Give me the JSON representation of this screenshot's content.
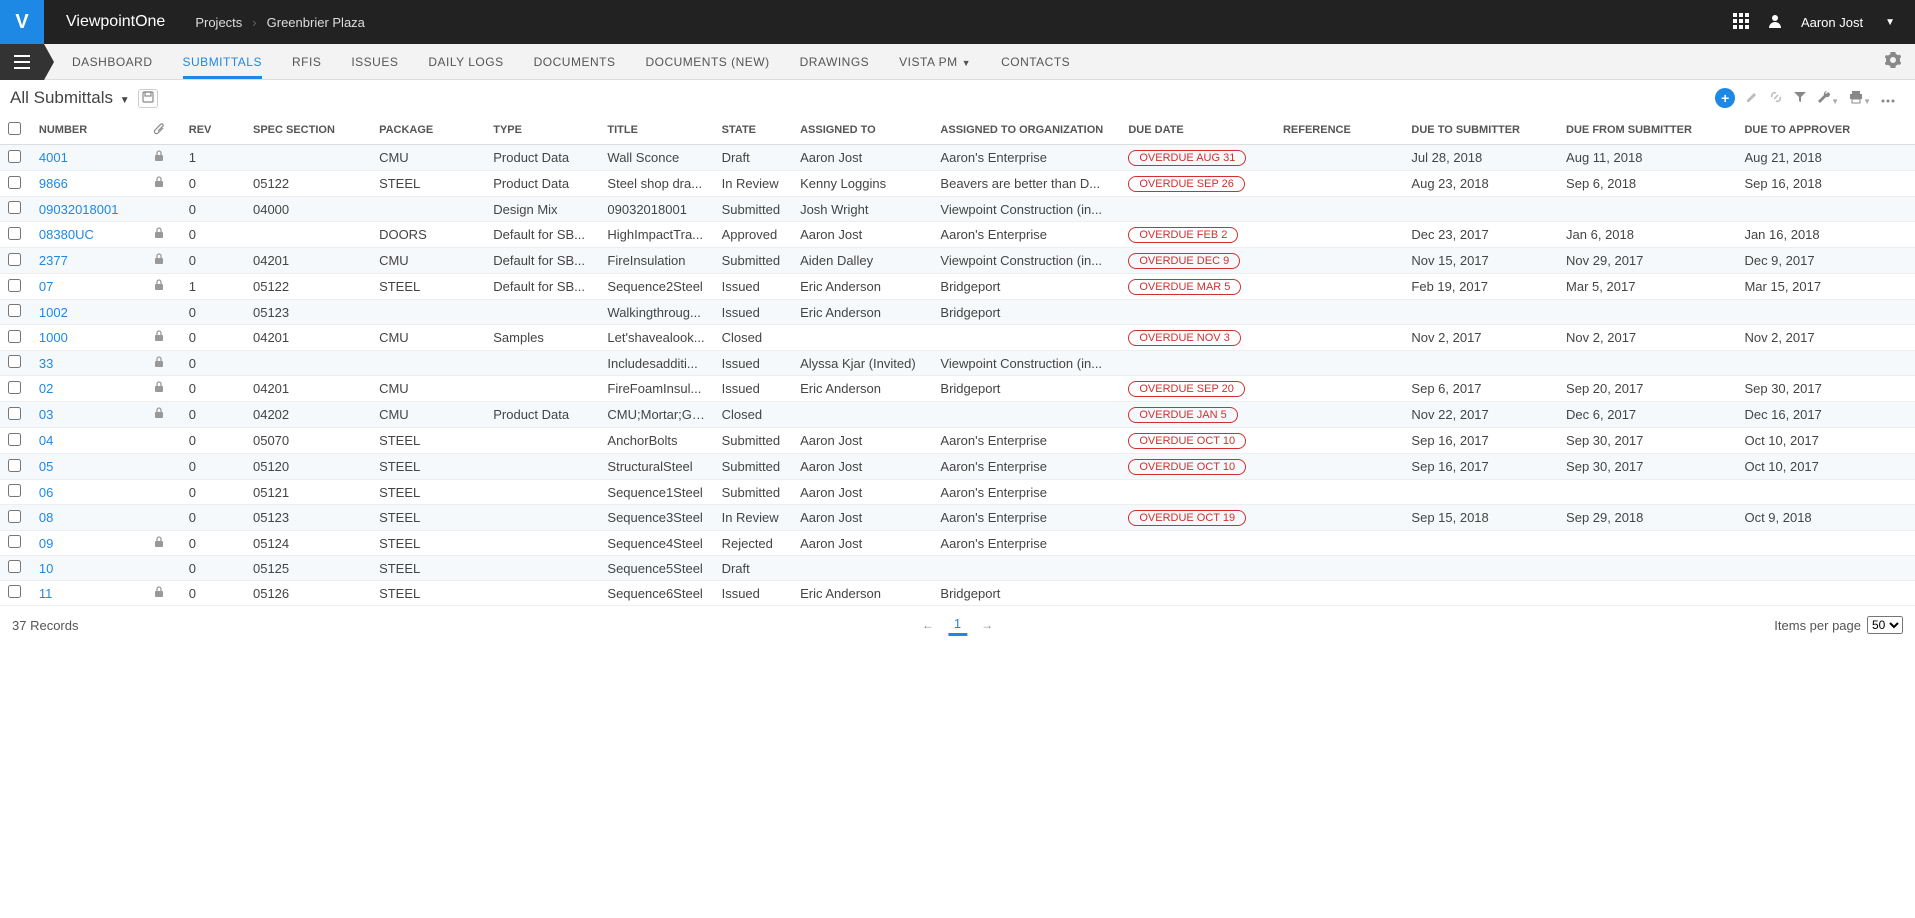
{
  "header": {
    "brand": "ViewpointOne",
    "breadcrumb": [
      "Projects",
      "Greenbrier Plaza"
    ],
    "username": "Aaron Jost"
  },
  "nav": {
    "tabs": [
      "DASHBOARD",
      "SUBMITTALS",
      "RFIS",
      "ISSUES",
      "DAILY LOGS",
      "DOCUMENTS",
      "DOCUMENTS (NEW)",
      "DRAWINGS",
      "VISTA PM",
      "CONTACTS"
    ],
    "active": "SUBMITTALS",
    "dropdown_tabs": [
      "VISTA PM"
    ]
  },
  "page": {
    "title": "All Submittals"
  },
  "columns": [
    "NUMBER",
    "",
    "REV",
    "SPEC SECTION",
    "PACKAGE",
    "TYPE",
    "TITLE",
    "STATE",
    "ASSIGNED TO",
    "ASSIGNED TO ORGANIZATION",
    "DUE DATE",
    "REFERENCE",
    "DUE TO SUBMITTER",
    "DUE FROM SUBMITTER",
    "DUE TO APPROVER"
  ],
  "rows": [
    {
      "number": "4001",
      "lock": true,
      "rev": "1",
      "spec": "",
      "package": "CMU",
      "type": "Product Data",
      "title": "Wall Sconce",
      "state": "Draft",
      "assigned": "Aaron Jost",
      "org": "Aaron's Enterprise",
      "due": "OVERDUE AUG 31",
      "overdue": true,
      "ref": "",
      "dueToSub": "Jul 28, 2018",
      "dueFromSub": "Aug 11, 2018",
      "dueToApp": "Aug 21, 2018"
    },
    {
      "number": "9866",
      "lock": true,
      "rev": "0",
      "spec": "05122",
      "package": "STEEL",
      "type": "Product Data",
      "title": "Steel shop dra...",
      "state": "In Review",
      "assigned": "Kenny Loggins",
      "org": "Beavers are better than D...",
      "due": "OVERDUE SEP 26",
      "overdue": true,
      "ref": "",
      "dueToSub": "Aug 23, 2018",
      "dueFromSub": "Sep 6, 2018",
      "dueToApp": "Sep 16, 2018"
    },
    {
      "number": "09032018001",
      "lock": false,
      "rev": "0",
      "spec": "04000",
      "package": "",
      "type": "Design Mix",
      "title": "09032018001",
      "state": "Submitted",
      "assigned": "Josh Wright",
      "org": "Viewpoint Construction (in...",
      "due": "",
      "overdue": false,
      "ref": "",
      "dueToSub": "",
      "dueFromSub": "",
      "dueToApp": ""
    },
    {
      "number": "08380UC",
      "lock": true,
      "rev": "0",
      "spec": "",
      "package": "DOORS",
      "type": "Default for SB...",
      "title": "HighImpactTra...",
      "state": "Approved",
      "assigned": "Aaron Jost",
      "org": "Aaron's Enterprise",
      "due": "OVERDUE FEB 2",
      "overdue": true,
      "ref": "",
      "dueToSub": "Dec 23, 2017",
      "dueFromSub": "Jan 6, 2018",
      "dueToApp": "Jan 16, 2018"
    },
    {
      "number": "2377",
      "lock": true,
      "rev": "0",
      "spec": "04201",
      "package": "CMU",
      "type": "Default for SB...",
      "title": "FireInsulation",
      "state": "Submitted",
      "assigned": "Aiden Dalley",
      "org": "Viewpoint Construction (in...",
      "due": "OVERDUE DEC 9",
      "overdue": true,
      "ref": "",
      "dueToSub": "Nov 15, 2017",
      "dueFromSub": "Nov 29, 2017",
      "dueToApp": "Dec 9, 2017"
    },
    {
      "number": "07",
      "lock": true,
      "rev": "1",
      "spec": "05122",
      "package": "STEEL",
      "type": "Default for SB...",
      "title": "Sequence2Steel",
      "state": "Issued",
      "assigned": "Eric Anderson",
      "org": "Bridgeport",
      "due": "OVERDUE MAR 5",
      "overdue": true,
      "ref": "",
      "dueToSub": "Feb 19, 2017",
      "dueFromSub": "Mar 5, 2017",
      "dueToApp": "Mar 15, 2017"
    },
    {
      "number": "1002",
      "lock": false,
      "rev": "0",
      "spec": "05123",
      "package": "",
      "type": "",
      "title": "Walkingthroug...",
      "state": "Issued",
      "assigned": "Eric Anderson",
      "org": "Bridgeport",
      "due": "",
      "overdue": false,
      "ref": "",
      "dueToSub": "",
      "dueFromSub": "",
      "dueToApp": ""
    },
    {
      "number": "1000",
      "lock": true,
      "rev": "0",
      "spec": "04201",
      "package": "CMU",
      "type": "Samples",
      "title": "Let'shavealook...",
      "state": "Closed",
      "assigned": "",
      "org": "",
      "due": "OVERDUE NOV 3",
      "overdue": true,
      "ref": "",
      "dueToSub": "Nov 2, 2017",
      "dueFromSub": "Nov 2, 2017",
      "dueToApp": "Nov 2, 2017"
    },
    {
      "number": "33",
      "lock": true,
      "rev": "0",
      "spec": "",
      "package": "",
      "type": "",
      "title": "Includesadditi...",
      "state": "Issued",
      "assigned": "Alyssa Kjar (Invited)",
      "org": "Viewpoint Construction (in...",
      "due": "",
      "overdue": false,
      "ref": "",
      "dueToSub": "",
      "dueFromSub": "",
      "dueToApp": ""
    },
    {
      "number": "02",
      "lock": true,
      "rev": "0",
      "spec": "04201",
      "package": "CMU",
      "type": "",
      "title": "FireFoamInsul...",
      "state": "Issued",
      "assigned": "Eric Anderson",
      "org": "Bridgeport",
      "due": "OVERDUE SEP 20",
      "overdue": true,
      "ref": "",
      "dueToSub": "Sep 6, 2017",
      "dueFromSub": "Sep 20, 2017",
      "dueToApp": "Sep 30, 2017"
    },
    {
      "number": "03",
      "lock": true,
      "rev": "0",
      "spec": "04202",
      "package": "CMU",
      "type": "Product Data",
      "title": "CMU;Mortar;Gr...",
      "state": "Closed",
      "assigned": "",
      "org": "",
      "due": "OVERDUE JAN 5",
      "overdue": true,
      "ref": "",
      "dueToSub": "Nov 22, 2017",
      "dueFromSub": "Dec 6, 2017",
      "dueToApp": "Dec 16, 2017"
    },
    {
      "number": "04",
      "lock": false,
      "rev": "0",
      "spec": "05070",
      "package": "STEEL",
      "type": "",
      "title": "AnchorBolts",
      "state": "Submitted",
      "assigned": "Aaron Jost",
      "org": "Aaron's Enterprise",
      "due": "OVERDUE OCT 10",
      "overdue": true,
      "ref": "",
      "dueToSub": "Sep 16, 2017",
      "dueFromSub": "Sep 30, 2017",
      "dueToApp": "Oct 10, 2017"
    },
    {
      "number": "05",
      "lock": false,
      "rev": "0",
      "spec": "05120",
      "package": "STEEL",
      "type": "",
      "title": "StructuralSteel",
      "state": "Submitted",
      "assigned": "Aaron Jost",
      "org": "Aaron's Enterprise",
      "due": "OVERDUE OCT 10",
      "overdue": true,
      "ref": "",
      "dueToSub": "Sep 16, 2017",
      "dueFromSub": "Sep 30, 2017",
      "dueToApp": "Oct 10, 2017"
    },
    {
      "number": "06",
      "lock": false,
      "rev": "0",
      "spec": "05121",
      "package": "STEEL",
      "type": "",
      "title": "Sequence1Steel",
      "state": "Submitted",
      "assigned": "Aaron Jost",
      "org": "Aaron's Enterprise",
      "due": "",
      "overdue": false,
      "ref": "",
      "dueToSub": "",
      "dueFromSub": "",
      "dueToApp": ""
    },
    {
      "number": "08",
      "lock": false,
      "rev": "0",
      "spec": "05123",
      "package": "STEEL",
      "type": "",
      "title": "Sequence3Steel",
      "state": "In Review",
      "assigned": "Aaron Jost",
      "org": "Aaron's Enterprise",
      "due": "OVERDUE OCT 19",
      "overdue": true,
      "ref": "",
      "dueToSub": "Sep 15, 2018",
      "dueFromSub": "Sep 29, 2018",
      "dueToApp": "Oct 9, 2018"
    },
    {
      "number": "09",
      "lock": true,
      "rev": "0",
      "spec": "05124",
      "package": "STEEL",
      "type": "",
      "title": "Sequence4Steel",
      "state": "Rejected",
      "assigned": "Aaron Jost",
      "org": "Aaron's Enterprise",
      "due": "",
      "overdue": false,
      "ref": "",
      "dueToSub": "",
      "dueFromSub": "",
      "dueToApp": ""
    },
    {
      "number": "10",
      "lock": false,
      "rev": "0",
      "spec": "05125",
      "package": "STEEL",
      "type": "",
      "title": "Sequence5Steel",
      "state": "Draft",
      "assigned": "",
      "org": "",
      "due": "",
      "overdue": false,
      "ref": "",
      "dueToSub": "",
      "dueFromSub": "",
      "dueToApp": ""
    },
    {
      "number": "11",
      "lock": true,
      "rev": "0",
      "spec": "05126",
      "package": "STEEL",
      "type": "",
      "title": "Sequence6Steel",
      "state": "Issued",
      "assigned": "Eric Anderson",
      "org": "Bridgeport",
      "due": "",
      "overdue": false,
      "ref": "",
      "dueToSub": "",
      "dueFromSub": "",
      "dueToApp": ""
    }
  ],
  "footer": {
    "records": "37 Records",
    "page": "1",
    "perpage_label": "Items per page",
    "perpage_value": "50"
  }
}
